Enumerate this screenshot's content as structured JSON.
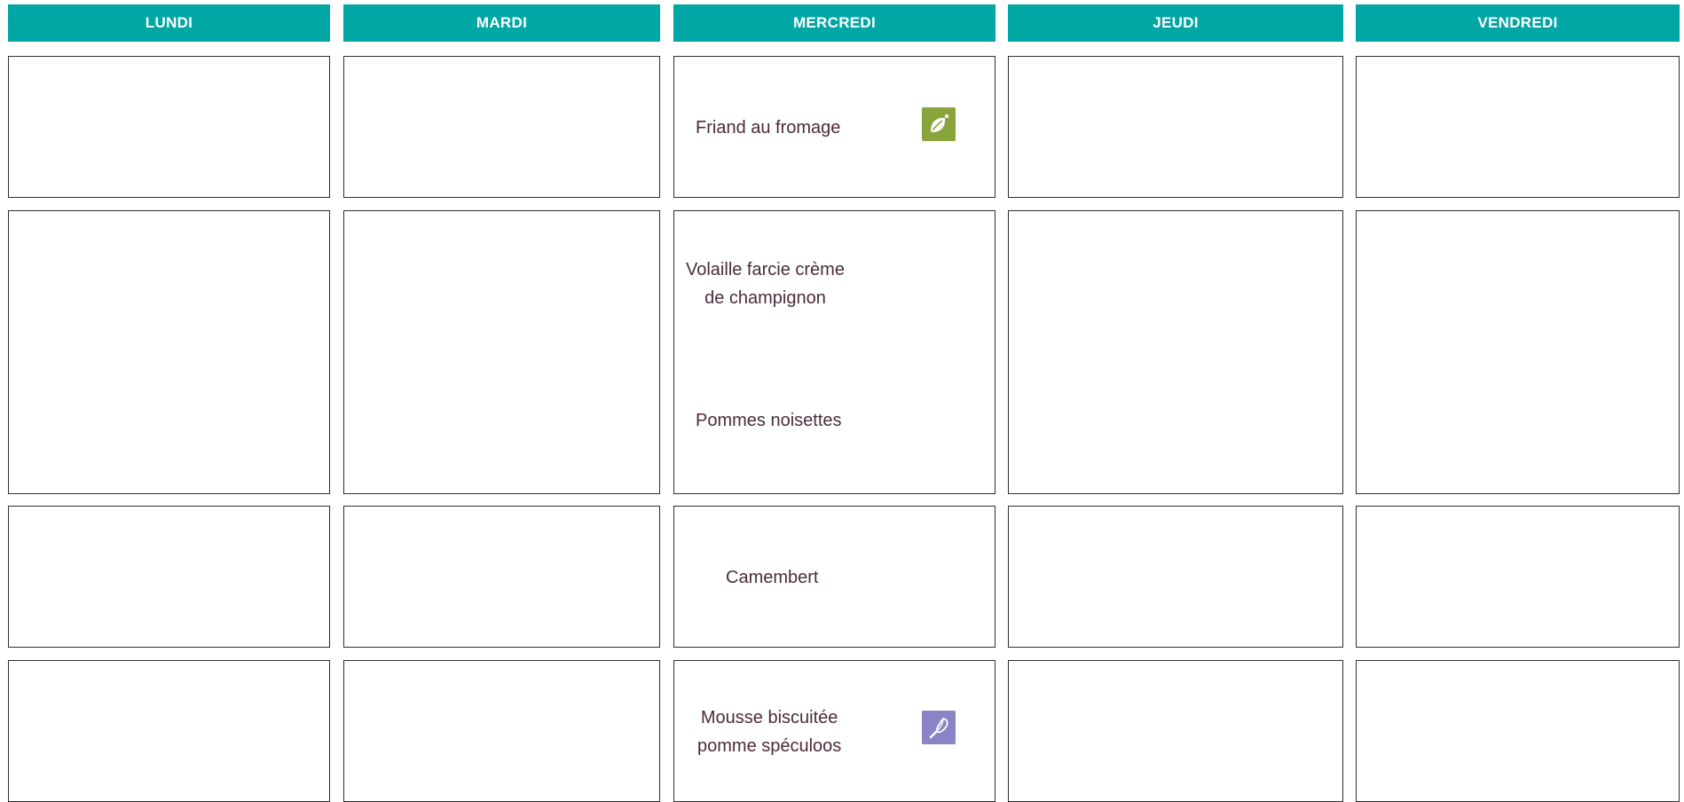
{
  "days": {
    "monday": "LUNDI",
    "tuesday": "MARDI",
    "wednesday": "MERCREDI",
    "thursday": "JEUDI",
    "friday": "VENDREDI"
  },
  "wednesday_menu": {
    "starter": {
      "name": "Friand au fromage",
      "badge_icon": "leaf-icon",
      "badge_color": "#8aa43c"
    },
    "main": {
      "line1": "Volaille farcie crème",
      "line2": "de champignon"
    },
    "side": "Pommes noisettes",
    "cheese": "Camembert",
    "dessert": {
      "line1": "Mousse biscuitée",
      "line2": "pomme spéculoos",
      "badge_icon": "whisk-icon",
      "badge_color": "#8a84c6"
    }
  },
  "colors": {
    "header": "#00a7a5",
    "text": "#4a2c3a"
  }
}
